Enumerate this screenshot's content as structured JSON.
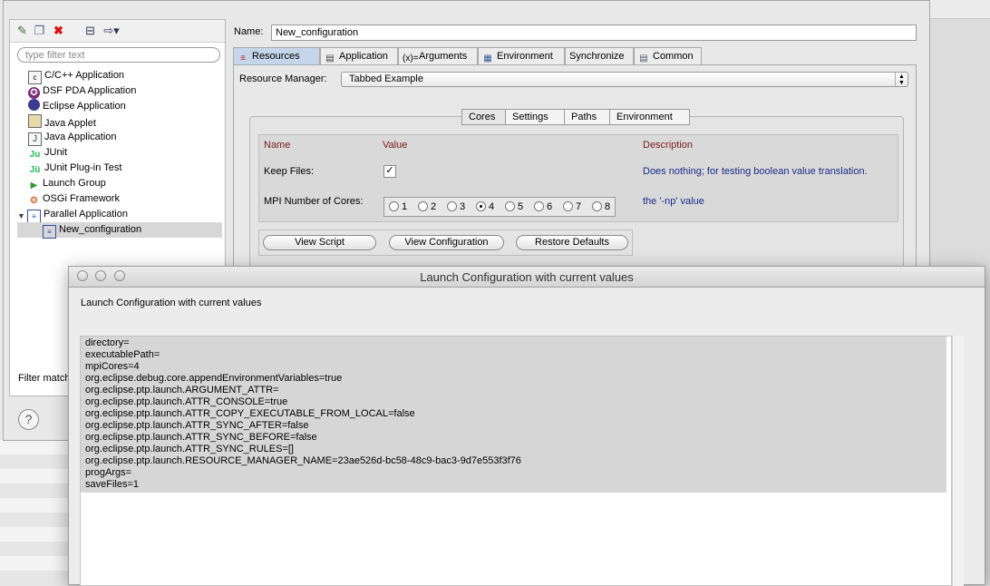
{
  "tree": {
    "filter_placeholder": "type filter text",
    "items": [
      {
        "label": "C/C++ Application",
        "icon": "c-app-icon"
      },
      {
        "label": "DSF PDA Application",
        "icon": "dsf-pda-icon"
      },
      {
        "label": "Eclipse Application",
        "icon": "eclipse-icon"
      },
      {
        "label": "Java Applet",
        "icon": "java-applet-icon"
      },
      {
        "label": "Java Application",
        "icon": "java-app-icon"
      },
      {
        "label": "JUnit",
        "icon": "junit-icon"
      },
      {
        "label": "JUnit Plug-in Test",
        "icon": "junit-plugin-icon"
      },
      {
        "label": "Launch Group",
        "icon": "launch-group-icon"
      },
      {
        "label": "OSGi Framework",
        "icon": "osgi-icon"
      },
      {
        "label": "Parallel Application",
        "icon": "parallel-app-icon"
      },
      {
        "label": "New_configuration",
        "icon": "parallel-config-icon"
      }
    ],
    "filter_match": "Filter match"
  },
  "config": {
    "name_label": "Name:",
    "name_value": "New_configuration",
    "tabs": [
      "Resources",
      "Application",
      "Arguments",
      "Environment",
      "Synchronize",
      "Common"
    ],
    "resource_manager_label": "Resource Manager:",
    "resource_manager_value": "Tabbed Example",
    "subtabs": [
      "Cores",
      "Settings",
      "Paths",
      "Environment"
    ],
    "headers": {
      "name": "Name",
      "value": "Value",
      "description": "Description"
    },
    "keep_files_label": "Keep Files:",
    "keep_files_checked": true,
    "keep_files_desc": "Does nothing; for testing boolean value translation.",
    "cores_label": "MPI Number of Cores:",
    "cores_options": [
      "1",
      "2",
      "3",
      "4",
      "5",
      "6",
      "7",
      "8"
    ],
    "cores_selected": "4",
    "cores_desc": "the '-np' value",
    "buttons": {
      "view_script": "View Script",
      "view_configuration": "View Configuration",
      "restore_defaults": "Restore Defaults"
    }
  },
  "overlay": {
    "title": "Launch Configuration with current values",
    "label": "Launch Configuration with current values",
    "lines": [
      "directory=",
      "executablePath=",
      "mpiCores=4",
      "org.eclipse.debug.core.appendEnvironmentVariables=true",
      "org.eclipse.ptp.launch.ARGUMENT_ATTR=",
      "org.eclipse.ptp.launch.ATTR_CONSOLE=true",
      "org.eclipse.ptp.launch.ATTR_COPY_EXECUTABLE_FROM_LOCAL=false",
      "org.eclipse.ptp.launch.ATTR_SYNC_AFTER=false",
      "org.eclipse.ptp.launch.ATTR_SYNC_BEFORE=false",
      "org.eclipse.ptp.launch.ATTR_SYNC_RULES=[]",
      "org.eclipse.ptp.launch.RESOURCE_MANAGER_NAME=23ae526d-bc58-48c9-bac3-9d7e553f3f76",
      "progArgs=",
      "saveFiles=1"
    ]
  }
}
